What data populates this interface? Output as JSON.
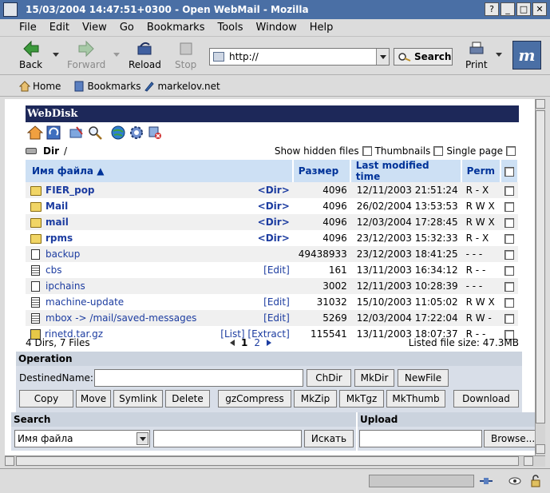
{
  "window": {
    "title": "15/03/2004 14:47:51+0300 - Open WebMail - Mozilla",
    "controls": [
      "?",
      "_",
      "□",
      "✕"
    ]
  },
  "menu": [
    "File",
    "Edit",
    "View",
    "Go",
    "Bookmarks",
    "Tools",
    "Window",
    "Help"
  ],
  "nav": {
    "back": "Back",
    "forward": "Forward",
    "reload": "Reload",
    "stop": "Stop",
    "url": "http://",
    "search": "Search",
    "print": "Print"
  },
  "personal": {
    "home": "Home",
    "bookmarks": "Bookmarks",
    "site": "markelov.net"
  },
  "webdisk": {
    "title": "WebDisk",
    "dir_label": "Dir",
    "dir_path": "/",
    "show_hidden": "Show hidden files",
    "thumbnails": "Thumbnails",
    "single_page": "Single page",
    "columns": {
      "name": "Имя файла ▲",
      "size": "Размер",
      "modified": "Last modified time",
      "perm": "Perm"
    },
    "files": [
      {
        "name": "FIER_pop",
        "action": "<Dir>",
        "size": "4096",
        "date": "12/11/2003 21:51:24",
        "perm": "R - X",
        "type": "folder"
      },
      {
        "name": "Mail",
        "action": "<Dir>",
        "size": "4096",
        "date": "26/02/2004 13:53:53",
        "perm": "R W X",
        "type": "folder"
      },
      {
        "name": "mail",
        "action": "<Dir>",
        "size": "4096",
        "date": "12/03/2004 17:28:45",
        "perm": "R W X",
        "type": "folder"
      },
      {
        "name": "rpms",
        "action": "<Dir>",
        "size": "4096",
        "date": "23/12/2003 15:32:33",
        "perm": "R - X",
        "type": "folder"
      },
      {
        "name": "backup",
        "action": "",
        "size": "49438933",
        "date": "23/12/2003 18:41:25",
        "perm": "- - -",
        "type": "file"
      },
      {
        "name": "cbs",
        "action": "[Edit]",
        "size": "161",
        "date": "13/11/2003 16:34:12",
        "perm": "R - -",
        "type": "text"
      },
      {
        "name": "ipchains",
        "action": "",
        "size": "3002",
        "date": "12/11/2003 10:28:39",
        "perm": "- - -",
        "type": "file"
      },
      {
        "name": "machine-update",
        "action": "[Edit]",
        "size": "31032",
        "date": "15/10/2003 11:05:02",
        "perm": "R W X",
        "type": "text"
      },
      {
        "name": "mbox -> /mail/saved-messages",
        "action": "[Edit]",
        "size": "5269",
        "date": "12/03/2004 17:22:04",
        "perm": "R W -",
        "type": "text"
      },
      {
        "name": "rinetd.tar.gz",
        "action": "[List] [Extract]",
        "size": "115541",
        "date": "13/11/2003 18:07:37",
        "perm": "R - -",
        "type": "archive"
      }
    ],
    "summary": "4 Dirs, 7 Files",
    "pages": [
      "1",
      "2"
    ],
    "listed_size": "Listed file size: 47.3MB"
  },
  "operation": {
    "title": "Operation",
    "destined_label": "DestinedName:",
    "buttons_row1": [
      "ChDir",
      "MkDir",
      "NewFile"
    ],
    "buttons_row2": [
      "Copy",
      "Move",
      "Symlink",
      "Delete",
      "gzCompress",
      "MkZip",
      "MkTgz",
      "MkThumb",
      "Download"
    ]
  },
  "search": {
    "title": "Search",
    "field": "Имя файла",
    "button": "Искать"
  },
  "upload": {
    "title": "Upload",
    "button": "Browse..."
  }
}
